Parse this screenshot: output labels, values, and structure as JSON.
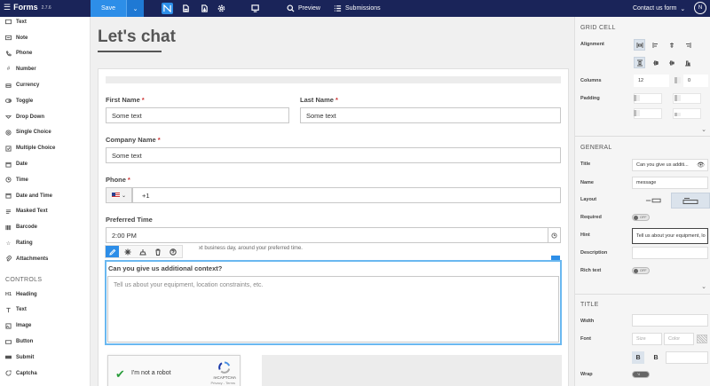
{
  "app": {
    "name": "Forms",
    "version": "2.7.6"
  },
  "topbar": {
    "save_label": "Save",
    "preview_label": "Preview",
    "submissions_label": "Submissions",
    "form_name": "Contact us form",
    "avatar_initial": "N"
  },
  "sidebar": {
    "fields": [
      {
        "label": "Text",
        "icon": "text-box-icon"
      },
      {
        "label": "Note",
        "icon": "note-icon"
      },
      {
        "label": "Phone",
        "icon": "phone-icon"
      },
      {
        "label": "Number",
        "icon": "hash-icon"
      },
      {
        "label": "Currency",
        "icon": "currency-icon"
      },
      {
        "label": "Toggle",
        "icon": "toggle-icon"
      },
      {
        "label": "Drop Down",
        "icon": "dropdown-icon"
      },
      {
        "label": "Single Choice",
        "icon": "radio-icon"
      },
      {
        "label": "Multiple Choice",
        "icon": "checkbox-icon"
      },
      {
        "label": "Date",
        "icon": "calendar-icon"
      },
      {
        "label": "Time",
        "icon": "clock-icon"
      },
      {
        "label": "Date and Time",
        "icon": "calendar-clock-icon"
      },
      {
        "label": "Masked Text",
        "icon": "masked-text-icon"
      },
      {
        "label": "Barcode",
        "icon": "barcode-icon"
      },
      {
        "label": "Rating",
        "icon": "star-icon"
      },
      {
        "label": "Attachments",
        "icon": "paperclip-icon"
      }
    ],
    "controls_heading": "CONTROLS",
    "controls": [
      {
        "label": "Heading",
        "icon": "heading-icon"
      },
      {
        "label": "Text",
        "icon": "text-icon"
      },
      {
        "label": "Image",
        "icon": "image-icon"
      },
      {
        "label": "Button",
        "icon": "button-icon"
      },
      {
        "label": "Submit",
        "icon": "submit-icon"
      },
      {
        "label": "Captcha",
        "icon": "captcha-icon"
      }
    ]
  },
  "form": {
    "title": "Let's chat",
    "first_name": {
      "label": "First Name",
      "value": "Some text"
    },
    "last_name": {
      "label": "Last Name",
      "value": "Some text"
    },
    "company_name": {
      "label": "Company Name",
      "value": "Some text"
    },
    "phone": {
      "label": "Phone",
      "value": "+1"
    },
    "preferred_time": {
      "label": "Preferred Time",
      "value": "2:00 PM",
      "hint": "xt business day, around your preferred time."
    },
    "context": {
      "label": "Can you give us additional context?",
      "placeholder": "Tell us about your equipment, location constraints, etc."
    },
    "captcha": {
      "label": "I'm not a robot",
      "brand": "reCAPTCHA",
      "links": "Privacy - Terms"
    },
    "required_mark": "*"
  },
  "panel": {
    "grid_cell_heading": "GRID CELL",
    "alignment_label": "Alignment",
    "columns_label": "Columns",
    "columns_value": "12",
    "offset_value": "0",
    "padding_label": "Padding",
    "general_heading": "GENERAL",
    "title_label": "Title",
    "title_value": "Can you give us additi...",
    "name_label": "Name",
    "name_value": "message",
    "layout_label": "Layout",
    "required_label": "Required",
    "required_state": "OFF",
    "hint_label": "Hint",
    "hint_value": "Tell us about your equipment, lo",
    "description_label": "Description",
    "rich_text_label": "Rich text",
    "rich_text_state": "OFF",
    "title_heading": "TITLE",
    "width_label": "Width",
    "font_label": "Font",
    "size_placeholder": "Size",
    "color_placeholder": "Color",
    "bold_label": "B",
    "bold2_label": "B",
    "wrap_label": "Wrap",
    "wrap_state": "ON"
  }
}
